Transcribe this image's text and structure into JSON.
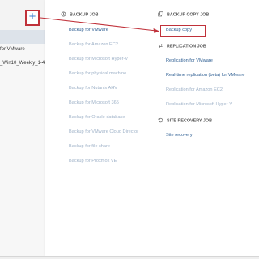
{
  "left_panel": {
    "items": [
      {
        "label": "for VMware"
      },
      {
        "label": "_Win10_Weekly_1-4"
      }
    ],
    "add_button": {
      "icon": "plus-icon",
      "glyph": "+"
    }
  },
  "menu": {
    "backup_job": {
      "header": "BACKUP JOB",
      "icon": "backup-job-icon",
      "items": [
        {
          "label": "Backup for VMware",
          "enabled": true
        },
        {
          "label": "Backup for Amazon EC2",
          "enabled": false
        },
        {
          "label": "Backup for Microsoft Hyper-V",
          "enabled": false
        },
        {
          "label": "Backup for physical machine",
          "enabled": false
        },
        {
          "label": "Backup for Nutanix AHV",
          "enabled": false
        },
        {
          "label": "Backup for Microsoft 365",
          "enabled": false
        },
        {
          "label": "Backup for Oracle database",
          "enabled": false
        },
        {
          "label": "Backup for VMware Cloud Director",
          "enabled": false
        },
        {
          "label": "Backup for file share",
          "enabled": false
        },
        {
          "label": "Backup for Proxmox VE",
          "enabled": false
        }
      ]
    },
    "backup_copy_job": {
      "header": "BACKUP COPY JOB",
      "icon": "backup-copy-icon",
      "items": [
        {
          "label": "Backup copy",
          "enabled": true
        }
      ]
    },
    "replication_job": {
      "header": "REPLICATION JOB",
      "icon": "replication-icon",
      "items": [
        {
          "label": "Replication for VMware",
          "enabled": true
        },
        {
          "label": "Real-time replication (beta) for VMware",
          "enabled": true
        },
        {
          "label": "Replication for Amazon EC2",
          "enabled": false
        },
        {
          "label": "Replication for Microsoft Hyper-V",
          "enabled": false
        }
      ]
    },
    "site_recovery_job": {
      "header": "SITE RECOVERY JOB",
      "icon": "site-recovery-icon",
      "items": [
        {
          "label": "Site recovery",
          "enabled": true
        }
      ]
    }
  },
  "colors": {
    "enabled_link": "#2f5f93",
    "disabled_link": "#9fb2c8",
    "highlight_red": "#c0313a",
    "plus_blue": "#3a7fd1"
  }
}
